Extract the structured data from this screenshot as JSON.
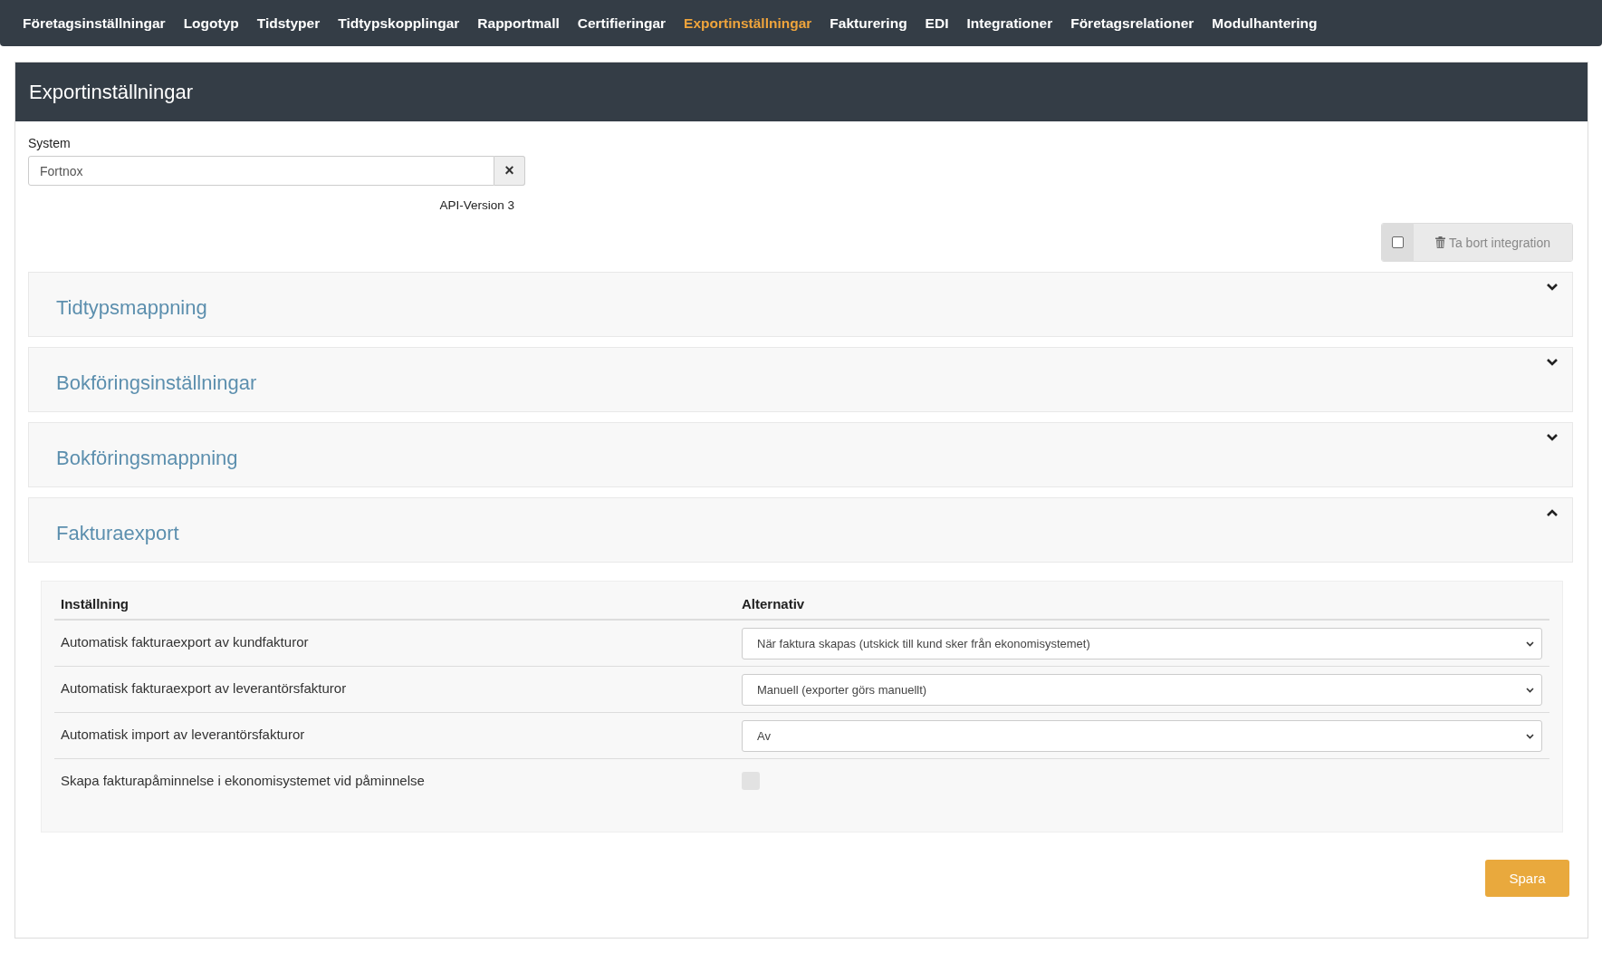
{
  "nav": [
    {
      "label": "Företagsinställningar",
      "selected": false
    },
    {
      "label": "Logotyp",
      "selected": false
    },
    {
      "label": "Tidstyper",
      "selected": false
    },
    {
      "label": "Tidtypskopplingar",
      "selected": false
    },
    {
      "label": "Rapportmall",
      "selected": false
    },
    {
      "label": "Certifieringar",
      "selected": false
    },
    {
      "label": "Exportinställningar",
      "selected": true
    },
    {
      "label": "Fakturering",
      "selected": false
    },
    {
      "label": "EDI",
      "selected": false
    },
    {
      "label": "Integrationer",
      "selected": false
    },
    {
      "label": "Företagsrelationer",
      "selected": false
    },
    {
      "label": "Modulhantering",
      "selected": false
    }
  ],
  "panel_title": "Exportinställningar",
  "system": {
    "label": "System",
    "value": "Fortnox",
    "clear": "×",
    "version": "API-Version 3"
  },
  "delete_integration": {
    "checked": false,
    "label": "Ta bort integration"
  },
  "sections": [
    {
      "title": "Tidtypsmappning",
      "expanded": false
    },
    {
      "title": "Bokföringsinställningar",
      "expanded": false
    },
    {
      "title": "Bokföringsmappning",
      "expanded": false
    },
    {
      "title": "Fakturaexport",
      "expanded": true
    }
  ],
  "table": {
    "columns": [
      "Inställning",
      "Alternativ"
    ],
    "rows": [
      {
        "setting": "Automatisk fakturaexport av kundfakturor",
        "kind": "select",
        "value": "När faktura skapas (utskick till kund sker från ekonomisystemet)"
      },
      {
        "setting": "Automatisk fakturaexport av leverantörsfakturor",
        "kind": "select",
        "value": "Manuell (exporter görs manuellt)"
      },
      {
        "setting": "Automatisk import av leverantörsfakturor",
        "kind": "select",
        "value": "Av"
      },
      {
        "setting": "Skapa fakturapåminnelse i ekonomisystemet vid påminnelse",
        "kind": "checkbox",
        "checked": false
      }
    ]
  },
  "save_button": "Spara"
}
